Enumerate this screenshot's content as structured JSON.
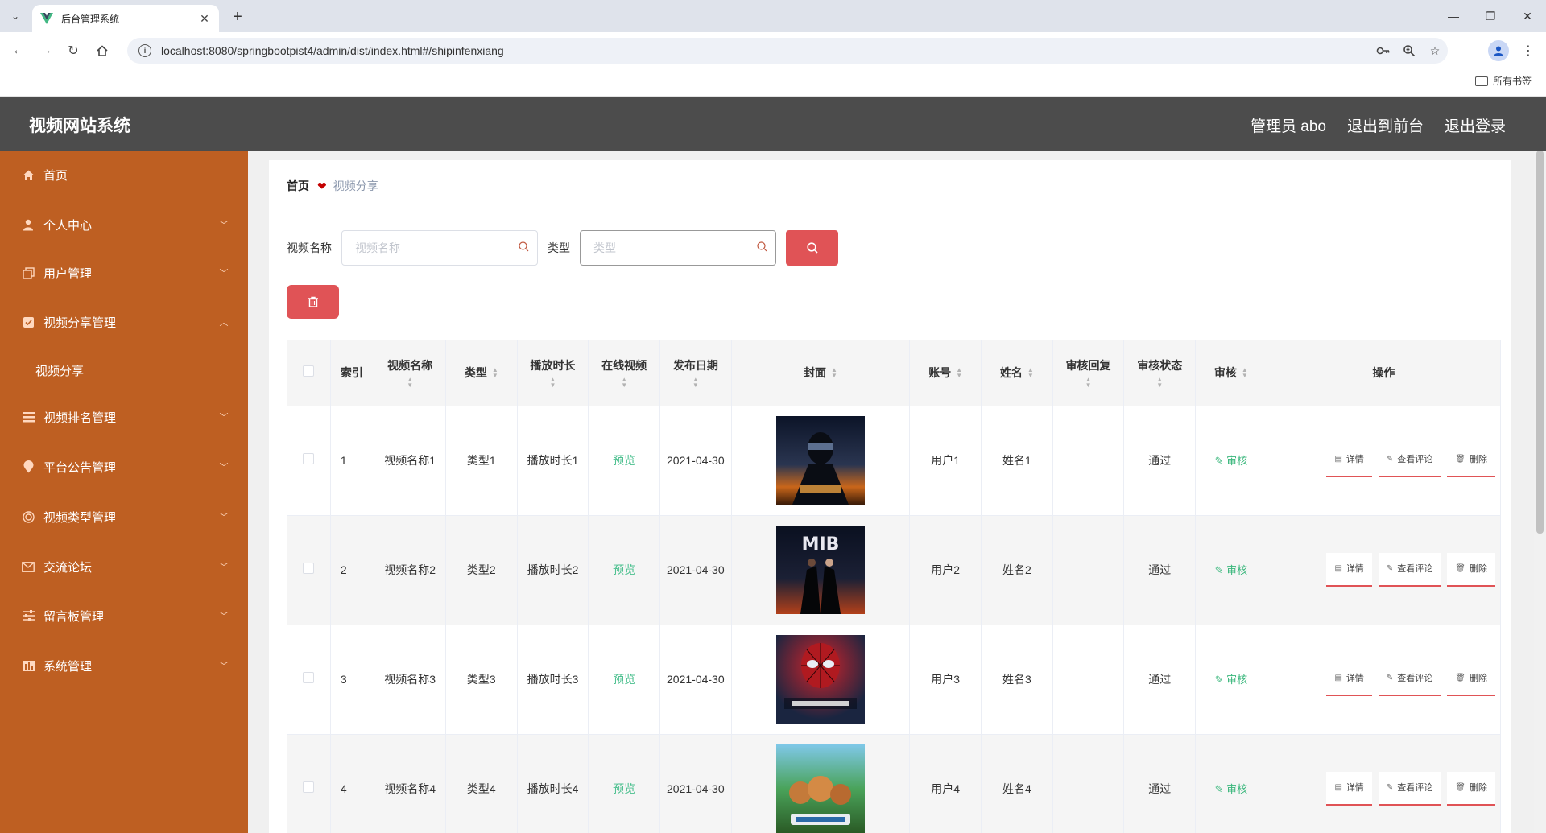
{
  "browser": {
    "tab_title": "后台管理系统",
    "url": "localhost:8080/springbootpist4/admin/dist/index.html#/shipinfenxiang",
    "bookmarks_label": "所有书签"
  },
  "header": {
    "title": "视频网站系统",
    "user_label": "管理员 abo",
    "to_front": "退出到前台",
    "logout": "退出登录"
  },
  "sidebar": {
    "items": [
      {
        "label": "首页",
        "icon": "home-icon"
      },
      {
        "label": "个人中心",
        "icon": "user-icon"
      },
      {
        "label": "用户管理",
        "icon": "copy-icon"
      },
      {
        "label": "视频分享管理",
        "icon": "checkbox-icon"
      },
      {
        "label": "视频排名管理",
        "icon": "list-icon"
      },
      {
        "label": "平台公告管理",
        "icon": "location-icon"
      },
      {
        "label": "视频类型管理",
        "icon": "circle-icon"
      },
      {
        "label": "交流论坛",
        "icon": "mail-icon"
      },
      {
        "label": "留言板管理",
        "icon": "sliders-icon"
      },
      {
        "label": "系统管理",
        "icon": "chart-icon"
      }
    ],
    "submenu": {
      "label": "视频分享"
    }
  },
  "breadcrumb": {
    "home": "首页",
    "current": "视频分享"
  },
  "search": {
    "name_label": "视频名称",
    "name_placeholder": "视频名称",
    "type_label": "类型",
    "type_placeholder": "类型"
  },
  "table": {
    "headers": {
      "index": "索引",
      "name": "视频名称",
      "type": "类型",
      "duration": "播放时长",
      "online": "在线视频",
      "date": "发布日期",
      "cover": "封面",
      "account": "账号",
      "realname": "姓名",
      "reply": "审核回复",
      "status": "审核状态",
      "audit": "审核",
      "ops": "操作"
    },
    "rows": [
      {
        "index": "1",
        "name": "视频名称1",
        "type": "类型1",
        "duration": "播放时长1",
        "online": "预览",
        "date": "2021-04-30",
        "account": "用户1",
        "realname": "姓名1",
        "reply": "",
        "status": "通过",
        "audit": "审核"
      },
      {
        "index": "2",
        "name": "视频名称2",
        "type": "类型2",
        "duration": "播放时长2",
        "online": "预览",
        "date": "2021-04-30",
        "account": "用户2",
        "realname": "姓名2",
        "reply": "",
        "status": "通过",
        "audit": "审核"
      },
      {
        "index": "3",
        "name": "视频名称3",
        "type": "类型3",
        "duration": "播放时长3",
        "online": "预览",
        "date": "2021-04-30",
        "account": "用户3",
        "realname": "姓名3",
        "reply": "",
        "status": "通过",
        "audit": "审核"
      },
      {
        "index": "4",
        "name": "视频名称4",
        "type": "类型4",
        "duration": "播放时长4",
        "online": "预览",
        "date": "2021-04-30",
        "account": "用户4",
        "realname": "姓名4",
        "reply": "",
        "status": "通过",
        "audit": "审核"
      }
    ],
    "ops": {
      "detail": "详情",
      "comments": "查看评论",
      "delete": "删除"
    }
  },
  "colors": {
    "sidebar": "#be5f22",
    "header": "#4c4c4c",
    "accent_red": "#e05356",
    "preview_green": "#4cc08f"
  }
}
